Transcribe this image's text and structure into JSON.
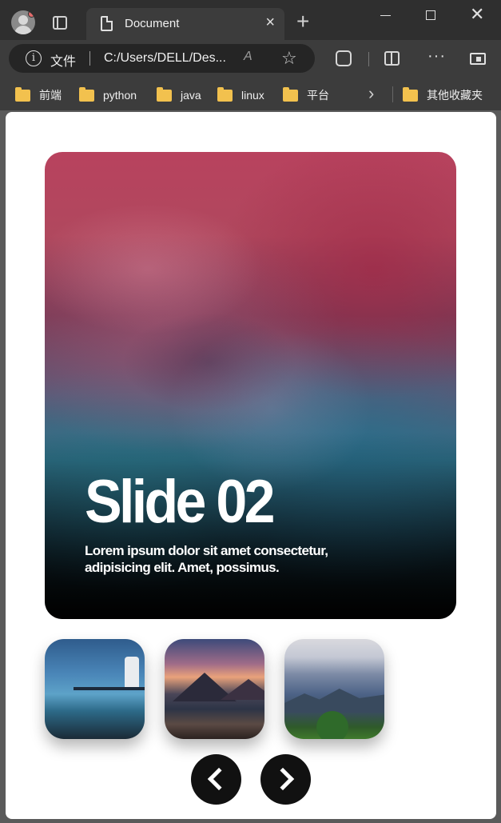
{
  "browser": {
    "tab_title": "Document",
    "tab_close": "×",
    "new_tab": "+",
    "window_close": "✕",
    "address": {
      "info_symbol": "i",
      "scheme_label": "文件",
      "url": "C:/Users/DELL/Des...",
      "read_aloud": "A",
      "favorite_symbol": "☆"
    },
    "more_label": "···",
    "bookmarks": [
      {
        "label": "前端"
      },
      {
        "label": "python"
      },
      {
        "label": "java"
      },
      {
        "label": "linux"
      },
      {
        "label": "平台"
      }
    ],
    "bookmarks_overflow": "›",
    "other_bookmarks": "其他收藏夹"
  },
  "slider": {
    "title": "Slide 02",
    "text": "Lorem ipsum dolor sit amet consectetur, adipisicing elit. Amet, possimus."
  },
  "colors": {
    "bookmark_folder": "#f2c14e",
    "nav_button": "#111111",
    "page_background": "#ffffff"
  }
}
